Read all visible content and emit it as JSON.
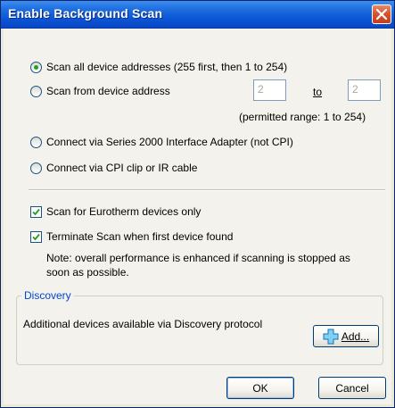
{
  "window": {
    "title": "Enable Background Scan"
  },
  "options": {
    "scan_all_label": "Scan all device addresses (255 first, then 1 to 254)",
    "scan_from_label": "Scan from device address",
    "from_value": "2",
    "to_label": "to",
    "to_value": "2",
    "permitted_range": "(permitted range: 1 to 254)",
    "series2000_label": "Connect via Series 2000 Interface Adapter (not CPI)",
    "cpi_label": "Connect via CPI clip or IR cable"
  },
  "checks": {
    "eurotherm_label": "Scan for Eurotherm devices only",
    "terminate_label": "Terminate Scan when first device found",
    "note": "Note: overall performance is enhanced if scanning is stopped as soon as possible."
  },
  "discovery": {
    "legend": "Discovery",
    "text": "Additional devices available via Discovery protocol",
    "add_label": "Add..."
  },
  "buttons": {
    "ok": "OK",
    "cancel": "Cancel"
  }
}
